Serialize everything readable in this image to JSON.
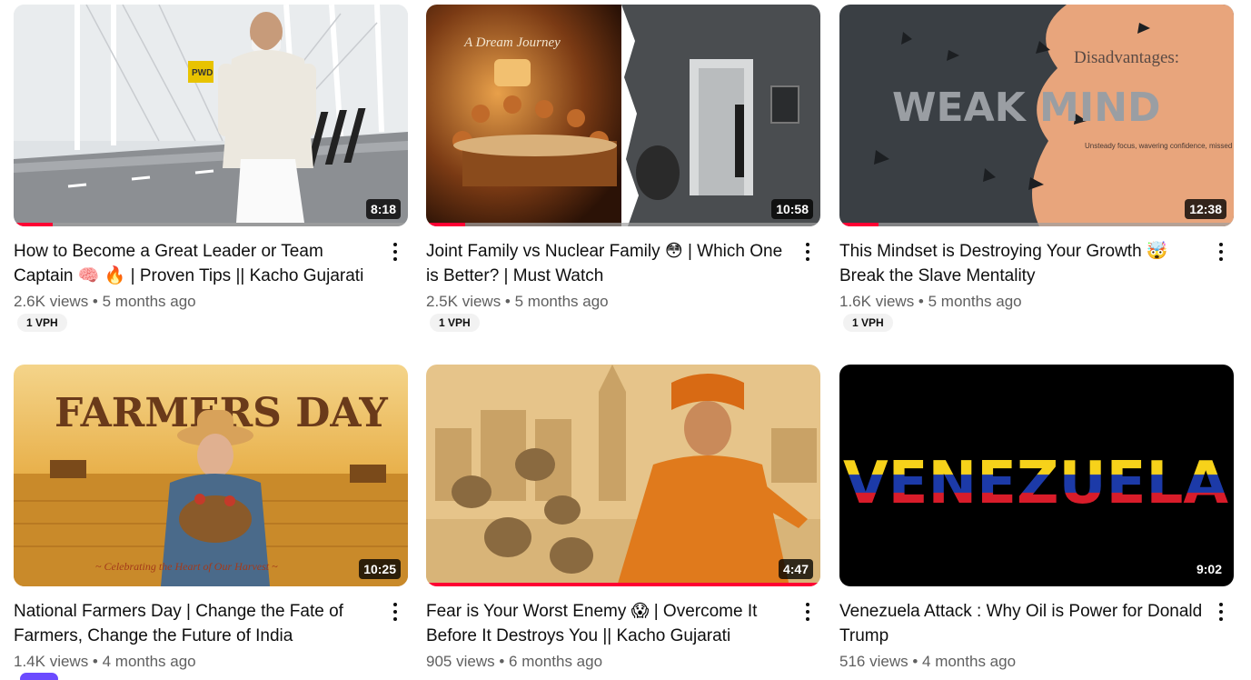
{
  "videos": [
    {
      "title": "How to Become a Great Leader or Team Captain 🧠 🔥 | Proven Tips || Kacho Gujarati",
      "duration": "8:18",
      "views": "2.6K views",
      "age": "5 months ago",
      "badge": "1 VPH",
      "progress": 0.1,
      "thumb_text": "PWD"
    },
    {
      "title": "Joint Family vs Nuclear Family 😳 | Which One is Better? | Must Watch",
      "duration": "10:58",
      "views": "2.5K views",
      "age": "5 months ago",
      "badge": "1 VPH",
      "progress": 0.1,
      "thumb_text": "A Dream Journey"
    },
    {
      "title": "This Mindset is Destroying Your Growth 🤯 Break the Slave Mentality",
      "duration": "12:38",
      "views": "1.6K views",
      "age": "5 months ago",
      "badge": "1 VPH",
      "progress": 0.1,
      "thumb_text": "Disadvantages:",
      "thumb_text2": "WEAK MIND",
      "thumb_text3": "Unsteady focus, wavering confidence, missed opportunities."
    },
    {
      "title": "National Farmers Day | Change the Fate of Farmers, Change the Future of India",
      "duration": "10:25",
      "views": "1.4K views",
      "age": "4 months ago",
      "badge": "",
      "progress": 0,
      "thumb_text": "FARMERS DAY",
      "thumb_text2": "~ Celebrating the Heart of Our Harvest ~"
    },
    {
      "title": "Fear is Your Worst Enemy 😱 | Overcome It Before It Destroys You || Kacho Gujarati",
      "duration": "4:47",
      "views": "905 views",
      "age": "6 months ago",
      "badge": "",
      "progress": 1.0
    },
    {
      "title": "Venezuela Attack : Why Oil is Power for Donald Trump",
      "duration": "9:02",
      "views": "516 views",
      "age": "4 months ago",
      "badge": "",
      "progress": 0,
      "thumb_text": "VENEZUELA"
    }
  ],
  "colors": {
    "progress": "#ff0033",
    "subtext": "#606060"
  }
}
